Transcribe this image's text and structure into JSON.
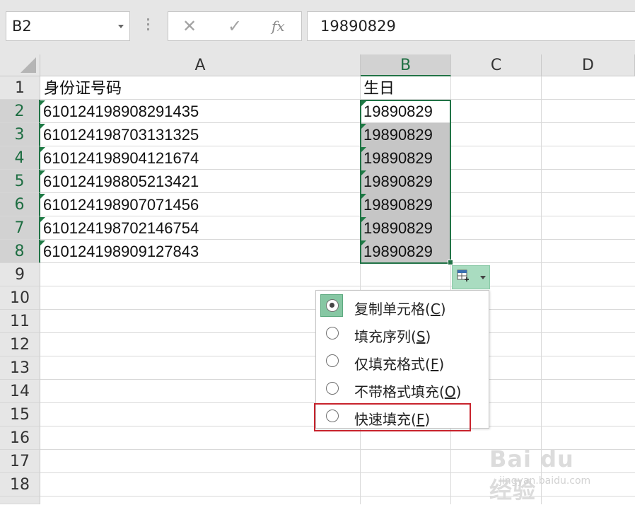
{
  "name_box": {
    "value": "B2"
  },
  "formula_bar": {
    "cancel_glyph": "✕",
    "enter_glyph": "✓",
    "fx_label": "fx",
    "value": "19890829"
  },
  "columns": [
    "A",
    "B",
    "C",
    "D"
  ],
  "selected_column": "B",
  "rows": [
    "1",
    "2",
    "3",
    "4",
    "5",
    "6",
    "7",
    "8",
    "9",
    "10",
    "11",
    "12",
    "13",
    "14",
    "15",
    "16",
    "17",
    "18"
  ],
  "cells": {
    "A1": "身份证号码",
    "B1": "生日",
    "A2": "610124198908291435",
    "B2": "19890829",
    "A3": "610124198703131325",
    "B3": "19890829",
    "A4": "610124198904121674",
    "B4": "19890829",
    "A5": "610124198805213421",
    "B5": "19890829",
    "A6": "610124198907071456",
    "B6": "19890829",
    "A7": "610124198702146754",
    "B7": "19890829",
    "A8": "610124198909127843",
    "B8": "19890829"
  },
  "autofill_menu": {
    "items": [
      {
        "label": "复制单元格(",
        "key": "C",
        "close": ")",
        "selected": true
      },
      {
        "label": "填充序列(",
        "key": "S",
        "close": ")",
        "selected": false
      },
      {
        "label": "仅填充格式(",
        "key": "F",
        "close": ")",
        "selected": false
      },
      {
        "label": "不带格式填充(",
        "key": "O",
        "close": ")",
        "selected": false
      },
      {
        "label": "快速填充(",
        "key": "F",
        "close": ")",
        "selected": false
      }
    ],
    "highlighted_item": "快速填充"
  },
  "colors": {
    "accent": "#217346",
    "highlight_border": "#c8232c",
    "fill_selection": "#c6c6c6"
  },
  "watermark": {
    "brand": "Bai du 经验",
    "url": "jingyan.baidu.com"
  }
}
